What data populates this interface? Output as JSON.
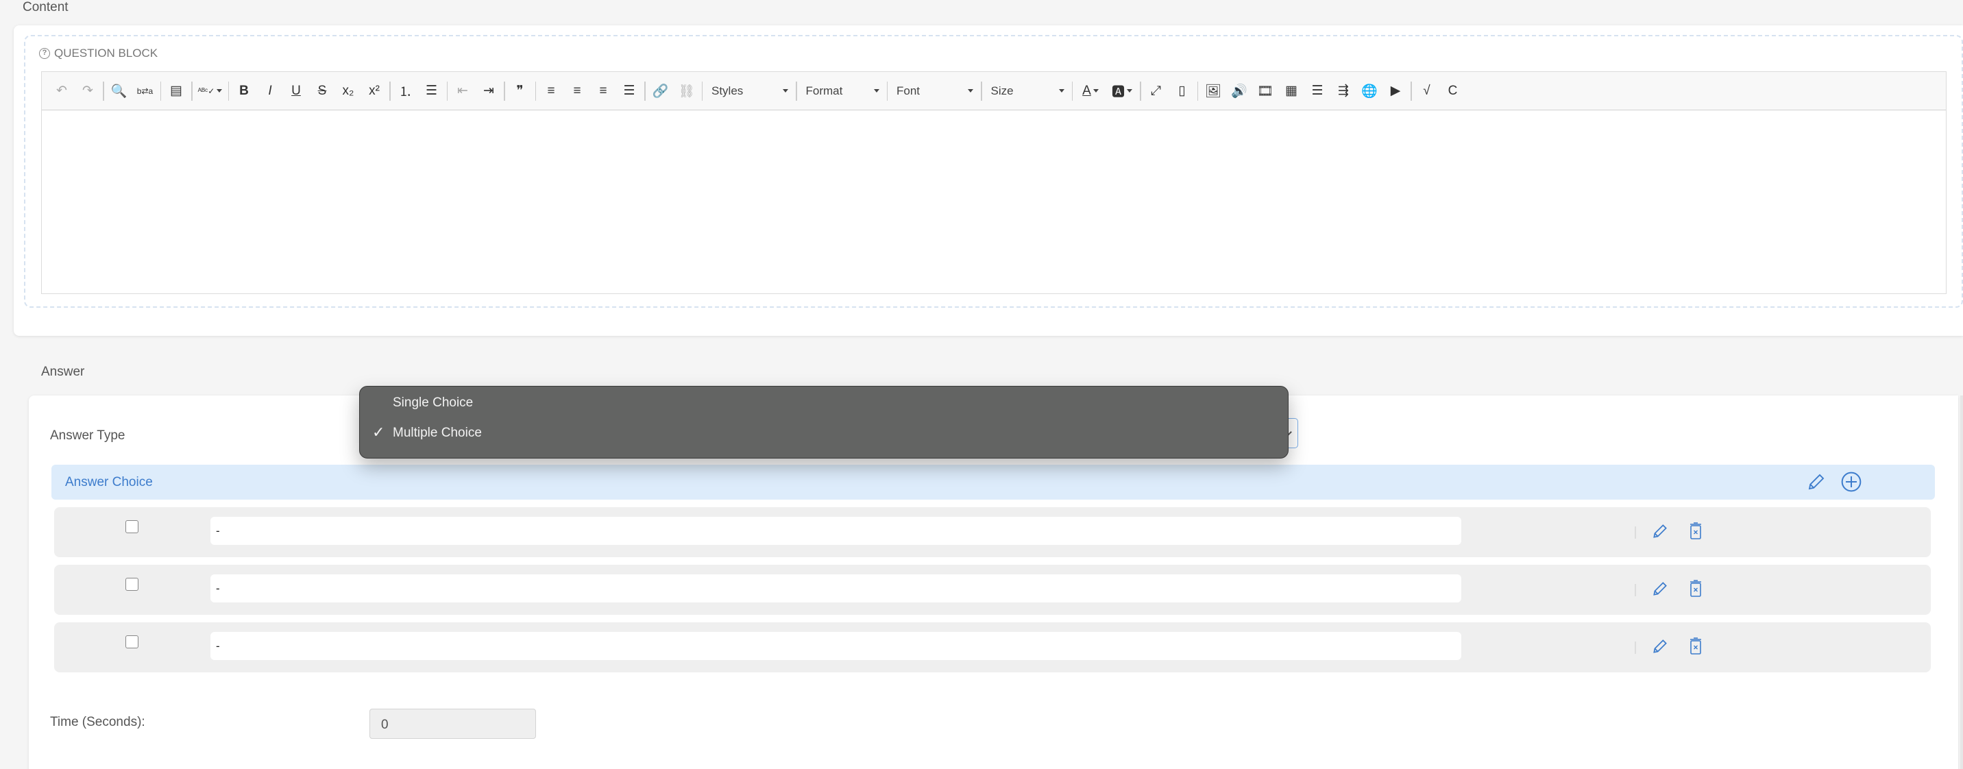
{
  "content_section": {
    "title": "Content",
    "question_block": {
      "label": "QUESTION BLOCK",
      "icon": "question-circle-icon"
    },
    "editor": {
      "toolbar": {
        "groups": [
          [
            {
              "name": "undo",
              "icon": "undo-icon",
              "glyph": "↶",
              "disabled": true
            },
            {
              "name": "redo",
              "icon": "redo-icon",
              "glyph": "↷",
              "disabled": true
            }
          ],
          [
            {
              "name": "find",
              "icon": "search-icon",
              "glyph": "🔍"
            },
            {
              "name": "replace",
              "icon": "find-replace-icon",
              "glyph": "b⇄a"
            }
          ],
          [
            {
              "name": "select-all",
              "icon": "select-all-icon",
              "glyph": "▤"
            }
          ],
          [
            {
              "name": "spellcheck",
              "icon": "spellcheck-icon",
              "glyph": "ᴬᴮᶜ✓",
              "dropdown": true
            }
          ],
          [
            {
              "name": "bold",
              "icon": "bold-icon",
              "glyph": "B"
            },
            {
              "name": "italic",
              "icon": "italic-icon",
              "glyph": "I"
            },
            {
              "name": "underline",
              "icon": "underline-icon",
              "glyph": "U"
            },
            {
              "name": "strike",
              "icon": "strikethrough-icon",
              "glyph": "S"
            },
            {
              "name": "subscript",
              "icon": "subscript-icon",
              "glyph": "x₂"
            },
            {
              "name": "superscript",
              "icon": "superscript-icon",
              "glyph": "x²"
            }
          ],
          [
            {
              "name": "numbered-list",
              "icon": "numbered-list-icon",
              "glyph": "⒈"
            },
            {
              "name": "bulleted-list",
              "icon": "bulleted-list-icon",
              "glyph": "☰"
            }
          ],
          [
            {
              "name": "outdent",
              "icon": "outdent-icon",
              "glyph": "⇤",
              "disabled": true
            },
            {
              "name": "indent",
              "icon": "indent-icon",
              "glyph": "⇥"
            }
          ],
          [
            {
              "name": "blockquote",
              "icon": "blockquote-icon",
              "glyph": "❞"
            }
          ],
          [
            {
              "name": "align-left",
              "icon": "align-left-icon",
              "glyph": "≡"
            },
            {
              "name": "align-center",
              "icon": "align-center-icon",
              "glyph": "≡"
            },
            {
              "name": "align-right",
              "icon": "align-right-icon",
              "glyph": "≡"
            },
            {
              "name": "justify",
              "icon": "align-justify-icon",
              "glyph": "☰"
            }
          ],
          [
            {
              "name": "link",
              "icon": "link-icon",
              "glyph": "🔗"
            },
            {
              "name": "unlink",
              "icon": "unlink-icon",
              "glyph": "⛓",
              "disabled": true
            }
          ]
        ],
        "combos": [
          {
            "name": "styles",
            "label": "Styles"
          },
          {
            "name": "format",
            "label": "Format"
          },
          {
            "name": "font",
            "label": "Font"
          },
          {
            "name": "size",
            "label": "Size"
          }
        ],
        "groups_after": [
          [
            {
              "name": "text-color",
              "icon": "text-color-icon",
              "glyph": "A",
              "dropdown": true
            },
            {
              "name": "bg-color",
              "icon": "background-color-icon",
              "glyph": "🅰",
              "dropdown": true
            }
          ],
          [
            {
              "name": "maximize",
              "icon": "maximize-icon",
              "glyph": "⤢"
            },
            {
              "name": "show-blocks",
              "icon": "show-blocks-icon",
              "glyph": "▯"
            }
          ],
          [
            {
              "name": "image",
              "icon": "image-icon",
              "glyph": "🖼"
            },
            {
              "name": "audio",
              "icon": "audio-icon",
              "glyph": "🔊"
            },
            {
              "name": "video",
              "icon": "video-icon",
              "glyph": "🎞"
            },
            {
              "name": "table",
              "icon": "table-icon",
              "glyph": "▦"
            },
            {
              "name": "horizontal-rule",
              "icon": "horizontal-rule-icon",
              "glyph": "☰"
            },
            {
              "name": "page-break",
              "icon": "page-break-icon",
              "glyph": "⇶"
            },
            {
              "name": "iframe",
              "icon": "globe-icon",
              "glyph": "🌐"
            },
            {
              "name": "youtube",
              "icon": "youtube-icon",
              "glyph": "▶"
            }
          ],
          [
            {
              "name": "math",
              "icon": "square-root-icon",
              "glyph": "√"
            },
            {
              "name": "chem",
              "icon": "chemistry-icon",
              "glyph": "C"
            }
          ]
        ]
      },
      "body_text": ""
    }
  },
  "answer_section": {
    "title": "Answer",
    "answer_type": {
      "label": "Answer Type",
      "selected": "Multiple Choice",
      "options": [
        "Single Choice",
        "Multiple Choice"
      ]
    },
    "answer_choice": {
      "title": "Answer Choice",
      "rows": [
        {
          "checked": false,
          "value": "-"
        },
        {
          "checked": false,
          "value": "-"
        },
        {
          "checked": false,
          "value": "-"
        }
      ]
    },
    "time": {
      "label": "Time (Seconds):",
      "value": "0"
    }
  },
  "colors": {
    "accent": "#3d7ccc",
    "choice_bar_bg": "#ddecfb",
    "dropdown_bg": "#636463",
    "row_bg": "#efefef",
    "page_bg": "#f5f5f5"
  }
}
